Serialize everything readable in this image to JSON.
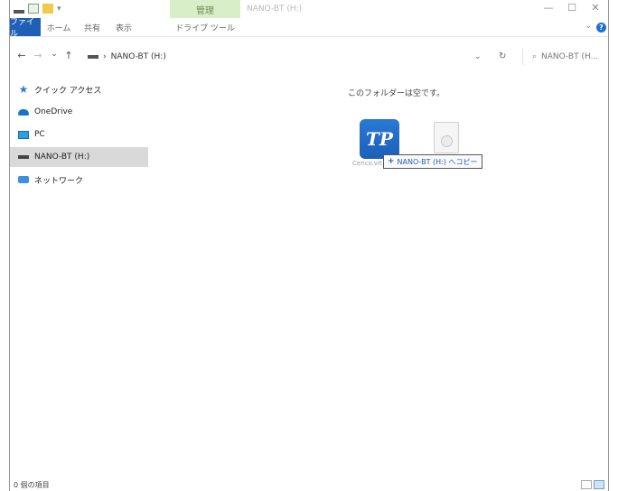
{
  "titlebar": {
    "manage_tab": "管理",
    "title": "NANO-BT (H:)",
    "minimize": "—",
    "maximize": "☐",
    "close": "✕"
  },
  "ribbon": {
    "tabs": [
      "ファイル",
      "ホーム",
      "共有",
      "表示",
      "ドライブ ツール"
    ],
    "help": "?"
  },
  "navbar": {
    "back": "←",
    "forward": "→",
    "recent": "⌄",
    "up": "↑",
    "breadcrumb_sep": "›",
    "location": "NANO-BT (H:)",
    "dropdown": "⌄",
    "refresh": "↻",
    "search_placeholder": "NANO-BT (H..."
  },
  "sidebar": {
    "items": [
      {
        "label": "クイック アクセス",
        "icon": "star-icon"
      },
      {
        "label": "OneDrive",
        "icon": "onedrive-icon"
      },
      {
        "label": "PC",
        "icon": "pc-icon"
      },
      {
        "label": "NANO-BT (H:)",
        "icon": "drive-icon",
        "selected": true
      },
      {
        "label": "ネットワーク",
        "icon": "network-icon"
      }
    ]
  },
  "content": {
    "empty_message": "このフォルダーは空です。",
    "drag_icon_text": "TP",
    "drag_icon_label": "Cenco.vit",
    "copy_tooltip": "NANO-BT (H:) へコピー",
    "copy_plus": "+"
  },
  "status": {
    "item_count": "0 個の項目"
  }
}
